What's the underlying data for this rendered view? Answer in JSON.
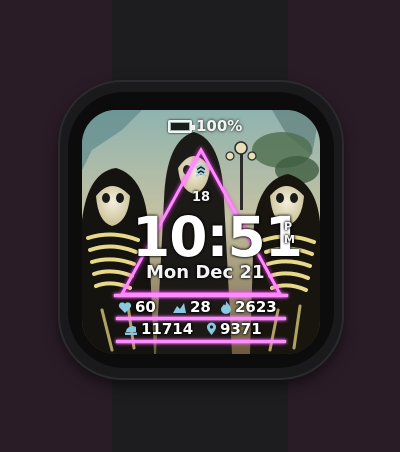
{
  "device": "watch-face",
  "battery": {
    "percent_label": "100%",
    "level": 1.0
  },
  "floors": {
    "count": "18",
    "icon": "floors-chevrons-icon"
  },
  "time": {
    "display": "10:51",
    "period_label": "PM"
  },
  "date": {
    "display": "Mon Dec 21"
  },
  "stats": {
    "heart_rate": {
      "value": "60",
      "icon": "heart-icon"
    },
    "active_minutes": {
      "value": "28",
      "icon": "active-minutes-icon"
    },
    "calories": {
      "value": "2623",
      "icon": "flame-icon"
    },
    "steps": {
      "value": "11714",
      "icon": "steps-icon"
    },
    "distance": {
      "value": "9371",
      "icon": "location-pin-icon"
    }
  },
  "colors": {
    "neon_accent": "#ff8cff",
    "text": "#ffffff",
    "band": "#1d1d1f",
    "background": "#2a1c27"
  }
}
